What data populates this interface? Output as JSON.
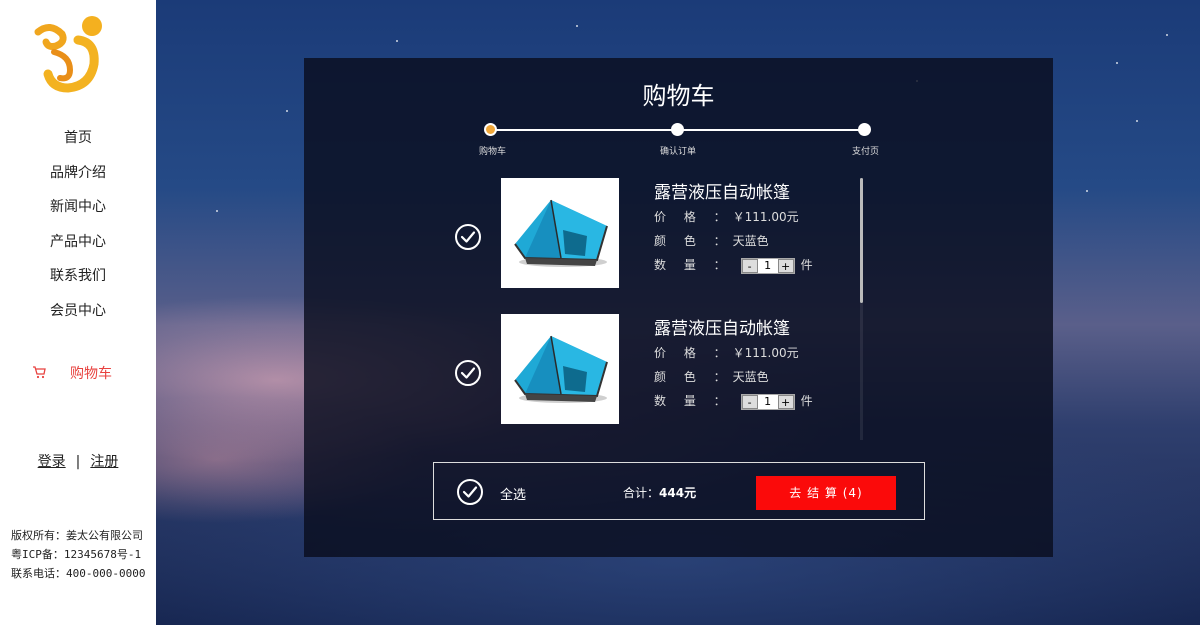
{
  "nav": {
    "items": [
      {
        "label": "首页"
      },
      {
        "label": "品牌介绍"
      },
      {
        "label": "新闻中心"
      },
      {
        "label": "产品中心"
      },
      {
        "label": "联系我们"
      },
      {
        "label": "会员中心"
      }
    ],
    "cart_label": "购物车"
  },
  "auth": {
    "login": "登录",
    "separator": "|",
    "register": "注册"
  },
  "footer": {
    "copyright": "版权所有：姜太公有限公司",
    "icp": "粤ICP备：12345678号-1",
    "phone": "联系电话：400-000-0000"
  },
  "cart": {
    "title": "购物车",
    "steps": [
      {
        "label": "购物车"
      },
      {
        "label": "确认订单"
      },
      {
        "label": "支付页"
      }
    ],
    "items": [
      {
        "name": "露营液压自动帐篷",
        "price_label": "价 格 ：",
        "price": "￥111.00元",
        "color_label": "颜 色 ：",
        "color": "天蓝色",
        "qty_label": "数 量 ：",
        "qty": "1",
        "minus": "-",
        "plus": "+",
        "unit": "件"
      },
      {
        "name": "露营液压自动帐篷",
        "price_label": "价 格 ：",
        "price": "￥111.00元",
        "color_label": "颜 色 ：",
        "color": "天蓝色",
        "qty_label": "数 量 ：",
        "qty": "1",
        "minus": "-",
        "plus": "+",
        "unit": "件"
      }
    ],
    "select_all": "全选",
    "total_label": "合计：",
    "total_value": "444元",
    "checkout": "去 结 算 (4)"
  },
  "colors": {
    "accent_red": "#fb0a0a",
    "cart_link": "#e8423f",
    "step_active": "#f1a83a"
  }
}
